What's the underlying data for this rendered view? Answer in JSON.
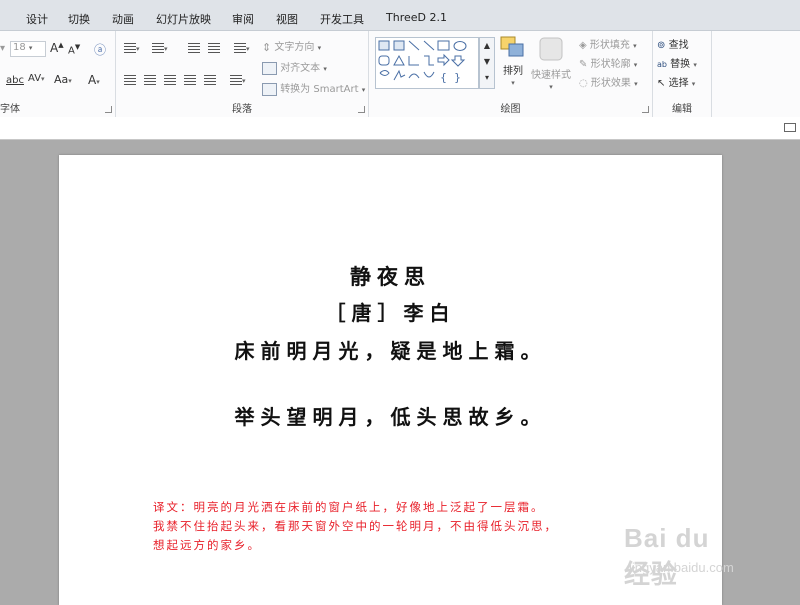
{
  "tabs": [
    "设计",
    "切换",
    "动画",
    "幻灯片放映",
    "审阅",
    "视图",
    "开发工具",
    "ThreeD 2.1"
  ],
  "font_group": {
    "label": "字体",
    "size_value": "18",
    "grow_label": "A",
    "shrink_label": "A",
    "case_label": "Aa",
    "clear_label": "A",
    "abc_label": "abc",
    "av_label": "AV",
    "color_label": "A"
  },
  "paragraph_group": {
    "label": "段落",
    "text_direction": "文字方向",
    "align_text": "对齐文本",
    "convert_smartart": "转换为 SmartArt"
  },
  "drawing_group": {
    "label": "绘图",
    "arrange": "排列",
    "quick_styles": "快速样式",
    "shape_fill": "形状填充",
    "shape_outline": "形状轮廓",
    "shape_effects": "形状效果"
  },
  "editing_group": {
    "label": "编辑",
    "find": "查找",
    "replace": "替换",
    "select": "选择"
  },
  "slide": {
    "title": "静夜思",
    "author": "［唐］李白",
    "line1": "床前明月光，疑是地上霜。",
    "line2": "举头望明月，低头思故乡。",
    "translation": [
      "译文：明亮的月光洒在床前的窗户纸上，好像地上泛起了一层霜。",
      "我禁不住抬起头来，看那天窗外空中的一轮明月，不由得低头沉思，",
      "想起远方的家乡。"
    ]
  },
  "watermark": {
    "brand": "Bai du 经验",
    "url": "jingyan.baidu.com"
  },
  "colors": {
    "ribbon_bg": "#fbfbfc",
    "tabbar_bg": "#dfe3e8",
    "canvas_bg": "#ababab",
    "note_red": "#e8202a"
  }
}
